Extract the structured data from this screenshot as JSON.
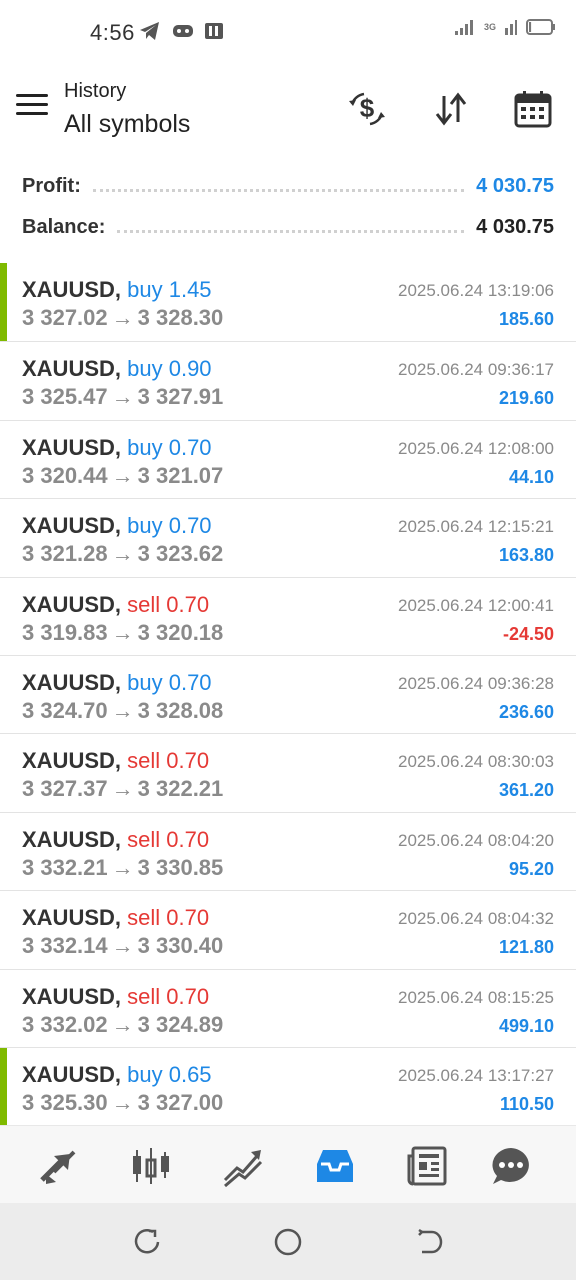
{
  "status": {
    "time": "4:56",
    "network": "3G",
    "battery_level": 0.1
  },
  "header": {
    "subtitle": "History",
    "title": "All symbols"
  },
  "summary": {
    "profit_label": "Profit:",
    "profit_value": "4 030.75",
    "balance_label": "Balance:",
    "balance_value": "4 030.75"
  },
  "colors": {
    "buy": "#1e88e5",
    "sell": "#e53935",
    "profit_positive": "#1e88e5",
    "profit_negative": "#e53935",
    "marker": "#7fba00"
  },
  "trades": [
    {
      "symbol": "XAUUSD,",
      "type": "buy 1.45",
      "side": "buy",
      "open": "3 327.02",
      "close": "3 328.30",
      "time": "2025.06.24 13:19:06",
      "profit": "185.60",
      "marked": true
    },
    {
      "symbol": "XAUUSD,",
      "type": "buy 0.90",
      "side": "buy",
      "open": "3 325.47",
      "close": "3 327.91",
      "time": "2025.06.24 09:36:17",
      "profit": "219.60",
      "marked": false
    },
    {
      "symbol": "XAUUSD,",
      "type": "buy 0.70",
      "side": "buy",
      "open": "3 320.44",
      "close": "3 321.07",
      "time": "2025.06.24 12:08:00",
      "profit": "44.10",
      "marked": false
    },
    {
      "symbol": "XAUUSD,",
      "type": "buy 0.70",
      "side": "buy",
      "open": "3 321.28",
      "close": "3 323.62",
      "time": "2025.06.24 12:15:21",
      "profit": "163.80",
      "marked": false
    },
    {
      "symbol": "XAUUSD,",
      "type": "sell 0.70",
      "side": "sell",
      "open": "3 319.83",
      "close": "3 320.18",
      "time": "2025.06.24 12:00:41",
      "profit": "-24.50",
      "marked": false
    },
    {
      "symbol": "XAUUSD,",
      "type": "buy 0.70",
      "side": "buy",
      "open": "3 324.70",
      "close": "3 328.08",
      "time": "2025.06.24 09:36:28",
      "profit": "236.60",
      "marked": false
    },
    {
      "symbol": "XAUUSD,",
      "type": "sell 0.70",
      "side": "sell",
      "open": "3 327.37",
      "close": "3 322.21",
      "time": "2025.06.24 08:30:03",
      "profit": "361.20",
      "marked": false
    },
    {
      "symbol": "XAUUSD,",
      "type": "sell 0.70",
      "side": "sell",
      "open": "3 332.21",
      "close": "3 330.85",
      "time": "2025.06.24 08:04:20",
      "profit": "95.20",
      "marked": false
    },
    {
      "symbol": "XAUUSD,",
      "type": "sell 0.70",
      "side": "sell",
      "open": "3 332.14",
      "close": "3 330.40",
      "time": "2025.06.24 08:04:32",
      "profit": "121.80",
      "marked": false
    },
    {
      "symbol": "XAUUSD,",
      "type": "sell 0.70",
      "side": "sell",
      "open": "3 332.02",
      "close": "3 324.89",
      "time": "2025.06.24 08:15:25",
      "profit": "499.10",
      "marked": false
    },
    {
      "symbol": "XAUUSD,",
      "type": "buy 0.65",
      "side": "buy",
      "open": "3 325.30",
      "close": "3 327.00",
      "time": "2025.06.24 13:17:27",
      "profit": "110.50",
      "marked": true
    }
  ],
  "price_arrow": "→",
  "bottom_nav": {
    "items": [
      {
        "icon": "quotes-icon",
        "active": false
      },
      {
        "icon": "chart-icon",
        "active": false
      },
      {
        "icon": "trade-icon",
        "active": false
      },
      {
        "icon": "history-icon",
        "active": true
      },
      {
        "icon": "news-icon",
        "active": false
      },
      {
        "icon": "messages-icon",
        "active": false
      }
    ],
    "active_color": "#1e88e5",
    "inactive_color": "#555555"
  }
}
